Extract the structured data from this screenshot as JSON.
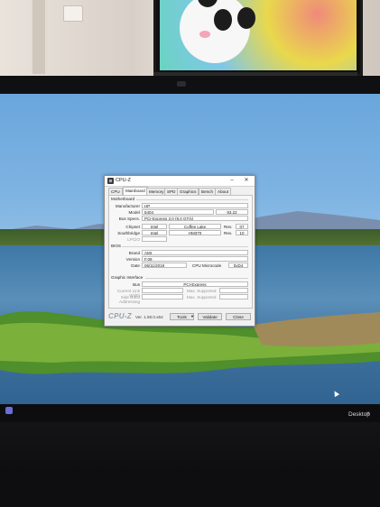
{
  "window": {
    "title": "CPU-Z",
    "minimize_symbol": "–",
    "close_symbol": "✕"
  },
  "tabs": [
    {
      "label": "CPU"
    },
    {
      "label": "Mainboard"
    },
    {
      "label": "Memory"
    },
    {
      "label": "SPD"
    },
    {
      "label": "Graphics"
    },
    {
      "label": "Bench"
    },
    {
      "label": "About"
    }
  ],
  "motherboard": {
    "group_label": "Motherboard",
    "manufacturer_label": "Manufacturer",
    "manufacturer": "HP",
    "model_label": "Model",
    "model": "8404",
    "model_rev": "93.22",
    "bus_specs_label": "Bus Specs.",
    "bus_specs": "PCI-Express 3.0 (8.0 GT/s)",
    "chipset_label": "Chipset",
    "chipset_vendor": "Intel",
    "chipset_model": "Coffee Lake",
    "chipset_rev_label": "Rev.",
    "chipset_rev": "07",
    "southbridge_label": "Southbridge",
    "southbridge_vendor": "Intel",
    "southbridge_model": "HM370",
    "southbridge_rev_label": "Rev.",
    "southbridge_rev": "10",
    "lpcio_label": "LPCIO"
  },
  "bios": {
    "group_label": "BIOS",
    "brand_label": "Brand",
    "brand": "AMI",
    "version_label": "Version",
    "version": "F.09",
    "date_label": "Date",
    "date": "06/11/2019",
    "microcode_label": "CPU Microcode",
    "microcode": "0xD4"
  },
  "graphic_interface": {
    "group_label": "Graphic Interface",
    "bus_label": "Bus",
    "bus": "PCI-Express",
    "current_link_width_label": "Current Link Width",
    "max_supported_label_1": "Max. Supported",
    "side_band_label": "Side Band Addressing",
    "max_supported_label_2": "Max. Supported"
  },
  "footer": {
    "brand": "CPU-Z",
    "version": "Ver. 1.90.0.x64",
    "tools_label": "Tools",
    "tools_arrow": "▼",
    "validate_label": "Validate",
    "close_label": "Close"
  },
  "taskbar": {
    "desktop_label": "Desktop",
    "desktop_icon_symbol": "»"
  }
}
